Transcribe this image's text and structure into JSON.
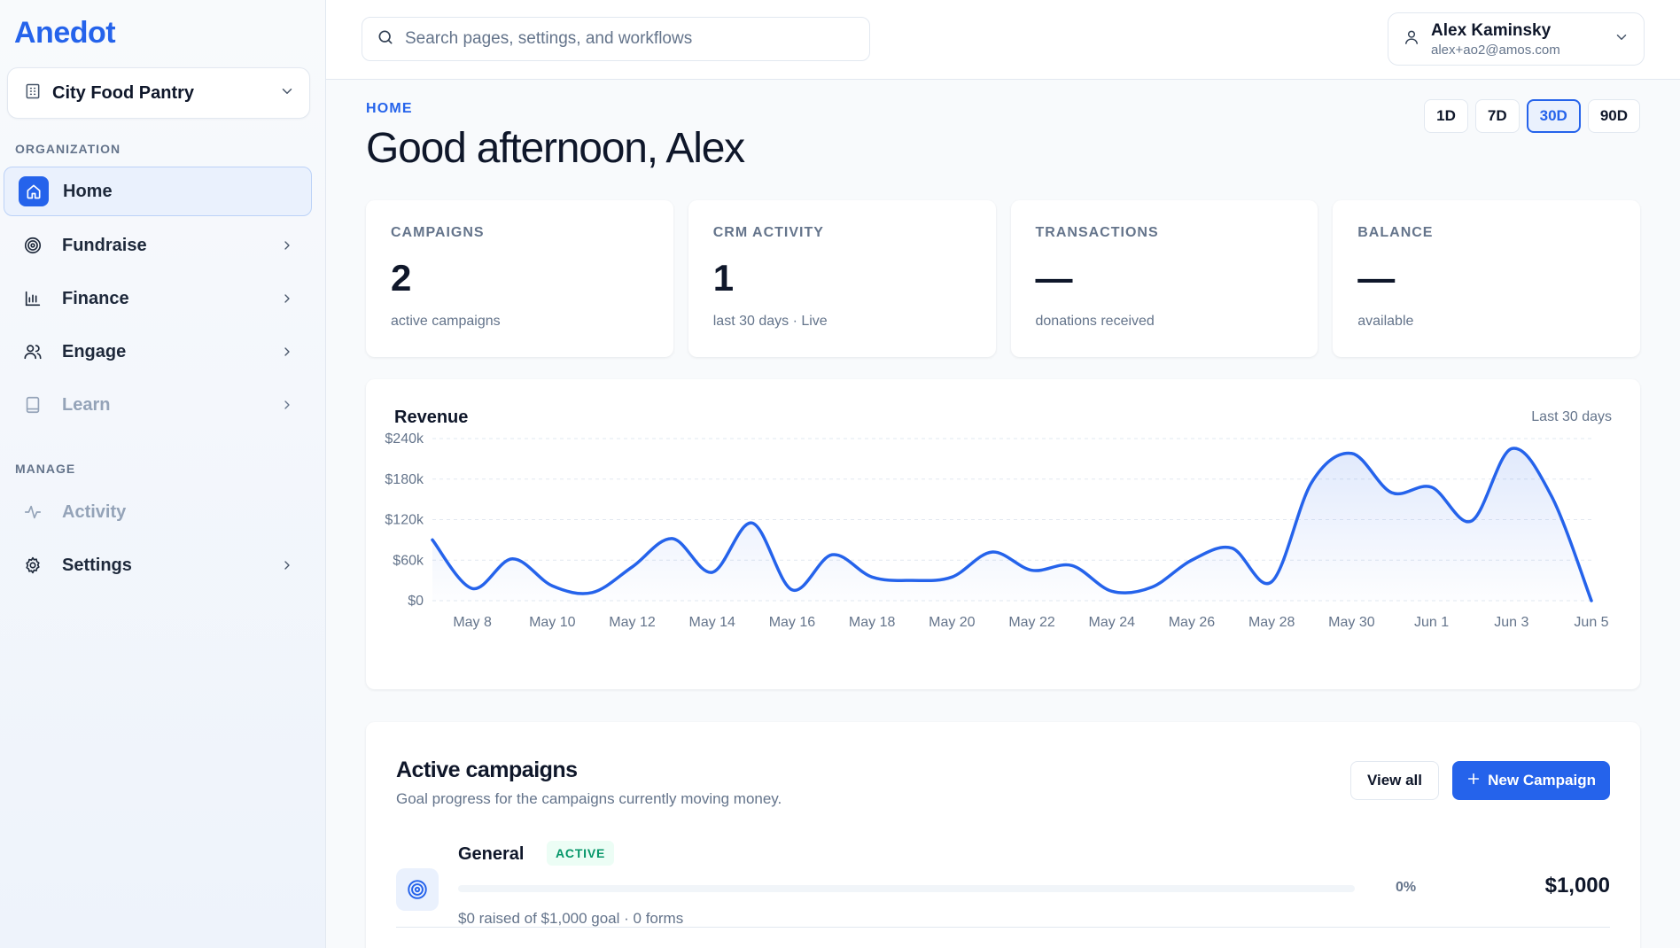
{
  "app": {
    "logo": "Anedot"
  },
  "sidebar": {
    "org": "City Food Pantry",
    "sections": {
      "organization": "ORGANIZATION",
      "manage": "MANAGE"
    },
    "items": [
      {
        "label": "Home",
        "icon": "home-icon"
      },
      {
        "label": "Fundraise",
        "icon": "target-icon"
      },
      {
        "label": "Finance",
        "icon": "bar-chart-icon"
      },
      {
        "label": "Engage",
        "icon": "users-icon"
      },
      {
        "label": "Learn",
        "icon": "book-icon"
      },
      {
        "label": "Activity",
        "icon": "activity-icon"
      },
      {
        "label": "Settings",
        "icon": "gear-icon"
      }
    ]
  },
  "header": {
    "search_placeholder": "Search pages, settings, and workflows",
    "user_name": "Alex Kaminsky",
    "user_email": "alex+ao2@amos.com"
  },
  "main": {
    "breadcrumb": "HOME",
    "greeting": "Good afternoon, Alex",
    "ranges": [
      "1D",
      "7D",
      "30D",
      "90D"
    ],
    "selected_range": "30D",
    "stats": [
      {
        "label": "CAMPAIGNS",
        "value": "2",
        "sub": "active campaigns"
      },
      {
        "label": "CRM ACTIVITY",
        "value": "1",
        "sub": "last 30 days · Live"
      },
      {
        "label": "TRANSACTIONS",
        "value": "—",
        "sub": "donations received"
      },
      {
        "label": "BALANCE",
        "value": "—",
        "sub": "available"
      }
    ],
    "chart_card": {
      "title": "Revenue",
      "range_label": "Last 30 days"
    },
    "campaigns": {
      "title": "Active campaigns",
      "subtitle": "Goal progress for the campaigns currently moving money.",
      "view_all": "View all",
      "new_campaign": "New Campaign",
      "items": [
        {
          "name": "General",
          "status": "ACTIVE",
          "progress_pct": 0,
          "pct_label": "0%",
          "goal": "$1,000",
          "meta": "$0 raised of $1,000 goal · 0 forms"
        }
      ]
    }
  },
  "colors": {
    "accent": "#2563eb",
    "accent_light": "#eaf1fd",
    "success": "#059669",
    "muted": "#64748b"
  },
  "chart_data": {
    "type": "area",
    "title": "Revenue",
    "xlabel": "",
    "ylabel": "",
    "ylim": [
      0,
      240000
    ],
    "yticks": [
      0,
      60000,
      120000,
      180000,
      240000
    ],
    "ytick_labels": [
      "$0",
      "$60k",
      "$120k",
      "$180k",
      "$240k"
    ],
    "xtick_labels": [
      "May 8",
      "May 10",
      "May 12",
      "May 14",
      "May 16",
      "May 18",
      "May 20",
      "May 22",
      "May 24",
      "May 26",
      "May 28",
      "May 30",
      "Jun 1",
      "Jun 3",
      "Jun 5"
    ],
    "grid": true,
    "series": [
      {
        "x": [
          "May 7",
          "May 8",
          "May 9",
          "May 10",
          "May 11",
          "May 12",
          "May 13",
          "May 14",
          "May 15",
          "May 16",
          "May 17",
          "May 18",
          "May 19",
          "May 20",
          "May 21",
          "May 22",
          "May 23",
          "May 24",
          "May 25",
          "May 26",
          "May 27",
          "May 28",
          "May 29",
          "May 30",
          "May 31",
          "Jun 1",
          "Jun 2",
          "Jun 3",
          "Jun 4",
          "Jun 5"
        ],
        "values": [
          90000,
          18000,
          62000,
          22000,
          12000,
          50000,
          92000,
          42000,
          115000,
          16000,
          68000,
          35000,
          30000,
          35000,
          72000,
          45000,
          52000,
          14000,
          20000,
          60000,
          78000,
          28000,
          175000,
          218000,
          160000,
          168000,
          118000,
          225000,
          155000,
          0
        ]
      }
    ]
  }
}
